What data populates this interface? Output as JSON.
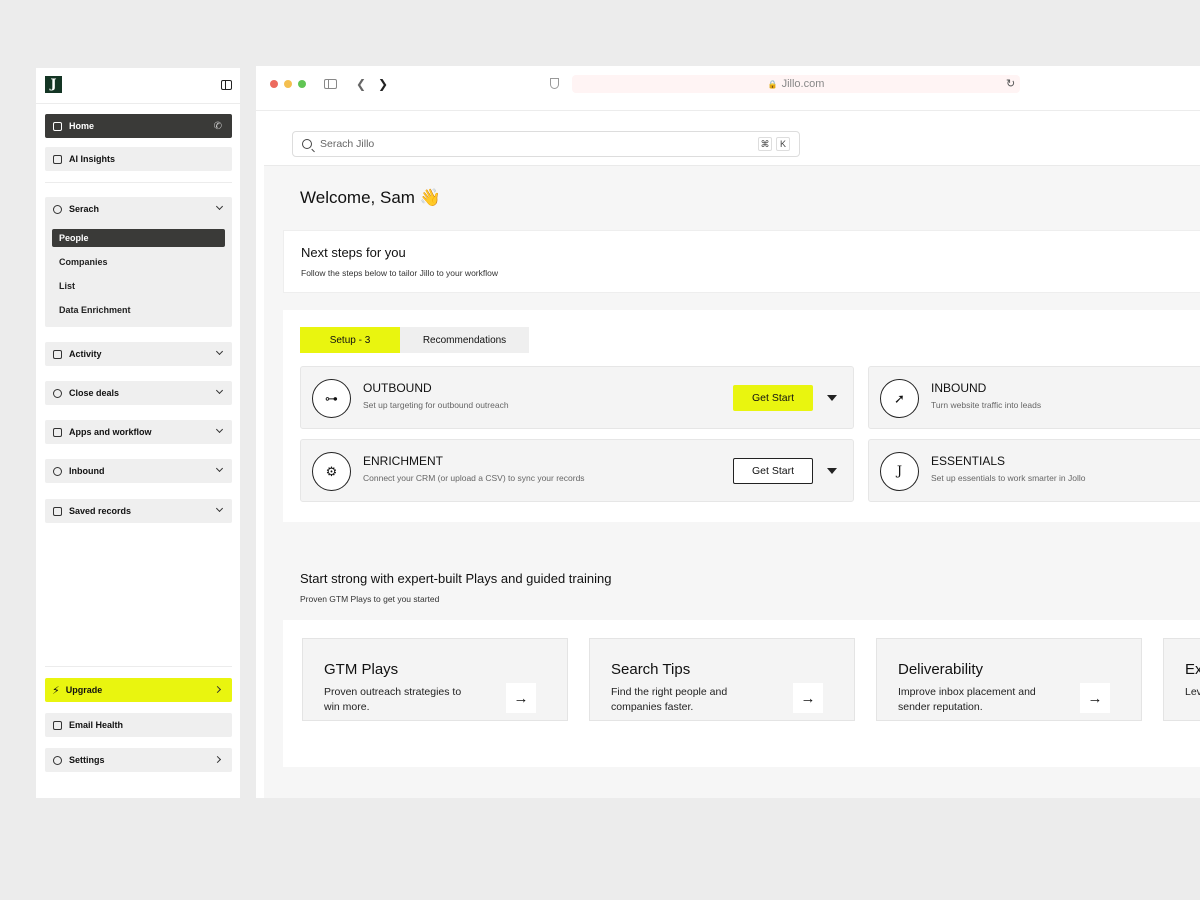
{
  "app": {
    "logo_letter": "J"
  },
  "sidebar": {
    "home": "Home",
    "ai_insights": "AI Insights",
    "search_group": {
      "label": "Serach",
      "items": [
        "People",
        "Companies",
        "List",
        "Data Enrichment"
      ]
    },
    "activity": "Activity",
    "close_deals": "Close deals",
    "apps_workflow": "Apps and workflow",
    "inbound": "Inbound",
    "saved_records": "Saved records",
    "upgrade": "Upgrade",
    "email_health": "Email Health",
    "settings": "Settings"
  },
  "browser": {
    "url": "Jillo.com",
    "traffic_colors": [
      "#ec6a5e",
      "#f4bf4f",
      "#61c554"
    ]
  },
  "search": {
    "placeholder": "Serach Jillo",
    "kbd_cmd": "⌘",
    "kbd_k": "K"
  },
  "welcome": "Welcome, Sam 👋",
  "next_steps": {
    "title": "Next steps for you",
    "subtitle": "Follow the steps below to tailor Jillo to your workflow"
  },
  "tabs": [
    "Setup - 3",
    "Recommendations"
  ],
  "steps": [
    {
      "title": "OUTBOUND",
      "subtitle": "Set up targeting for outbound outreach",
      "button": "Get Start",
      "icon": "outbound-icon"
    },
    {
      "title": "INBOUND",
      "subtitle": "Turn website traffic into leads",
      "icon": "inbound-icon"
    },
    {
      "title": "ENRICHMENT",
      "subtitle": "Connect your CRM (or upload a CSV) to sync your records",
      "button": "Get Start",
      "icon": "enrichment-icon"
    },
    {
      "title": "ESSENTIALS",
      "subtitle": "Set up essentials to work smarter in Jollo",
      "icon_letter": "J"
    }
  ],
  "plays": {
    "title": "Start strong with expert-built Plays and guided training",
    "subtitle": "Proven GTM Plays to get you started",
    "cards": [
      {
        "title": "GTM Plays",
        "desc": "Proven outreach strategies to win more."
      },
      {
        "title": "Search Tips",
        "desc": "Find the right people and companies faster."
      },
      {
        "title": "Deliverability",
        "desc": "Improve inbox placement and sender reputation."
      },
      {
        "title": "Ex",
        "desc": "Lev cou"
      }
    ]
  },
  "colors": {
    "accent": "#e9f50f",
    "dark": "#3a3a38",
    "logo_bg": "#143524"
  }
}
